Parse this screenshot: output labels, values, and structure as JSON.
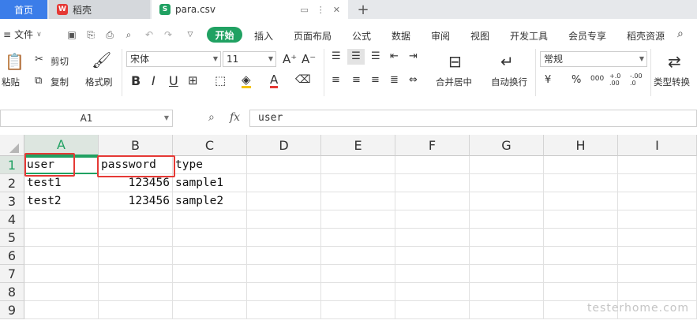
{
  "tabs": {
    "home": "首页",
    "daoke": "稻壳",
    "file": "para.csv",
    "file_icon": "S",
    "daoke_icon": "W"
  },
  "menu": {
    "file": "文件",
    "start": "开始",
    "items": [
      "插入",
      "页面布局",
      "公式",
      "数据",
      "审阅",
      "视图",
      "开发工具",
      "会员专享",
      "稻壳资源"
    ]
  },
  "ribbon": {
    "paste": "粘贴",
    "cut": "剪切",
    "copy": "复制",
    "format_painter": "格式刷",
    "font_name": "宋体",
    "font_size": "11",
    "merge_center": "合并居中",
    "wrap_text": "自动换行",
    "number_format": "常规",
    "type_convert": "类型转换",
    "currency": "¥",
    "percent": "%",
    "thousands": "000",
    "inc_decimal": "+.0 .00",
    "dec_decimal": "-.00 .0"
  },
  "formula_bar": {
    "cell_ref": "A1",
    "fx": "fx",
    "value": "user"
  },
  "columns": [
    "A",
    "B",
    "C",
    "D",
    "E",
    "F",
    "G",
    "H",
    "I"
  ],
  "rows": [
    "1",
    "2",
    "3",
    "4",
    "5",
    "6",
    "7",
    "8",
    "9"
  ],
  "cells": [
    [
      "user",
      "password",
      "type"
    ],
    [
      "test1",
      "123456",
      "sample1"
    ],
    [
      "test2",
      "123456",
      "sample2"
    ]
  ],
  "watermark": "testerhome.com",
  "colors": {
    "accent_green": "#20a162",
    "tab_blue": "#3b7de9",
    "highlight_red": "#e53935"
  }
}
